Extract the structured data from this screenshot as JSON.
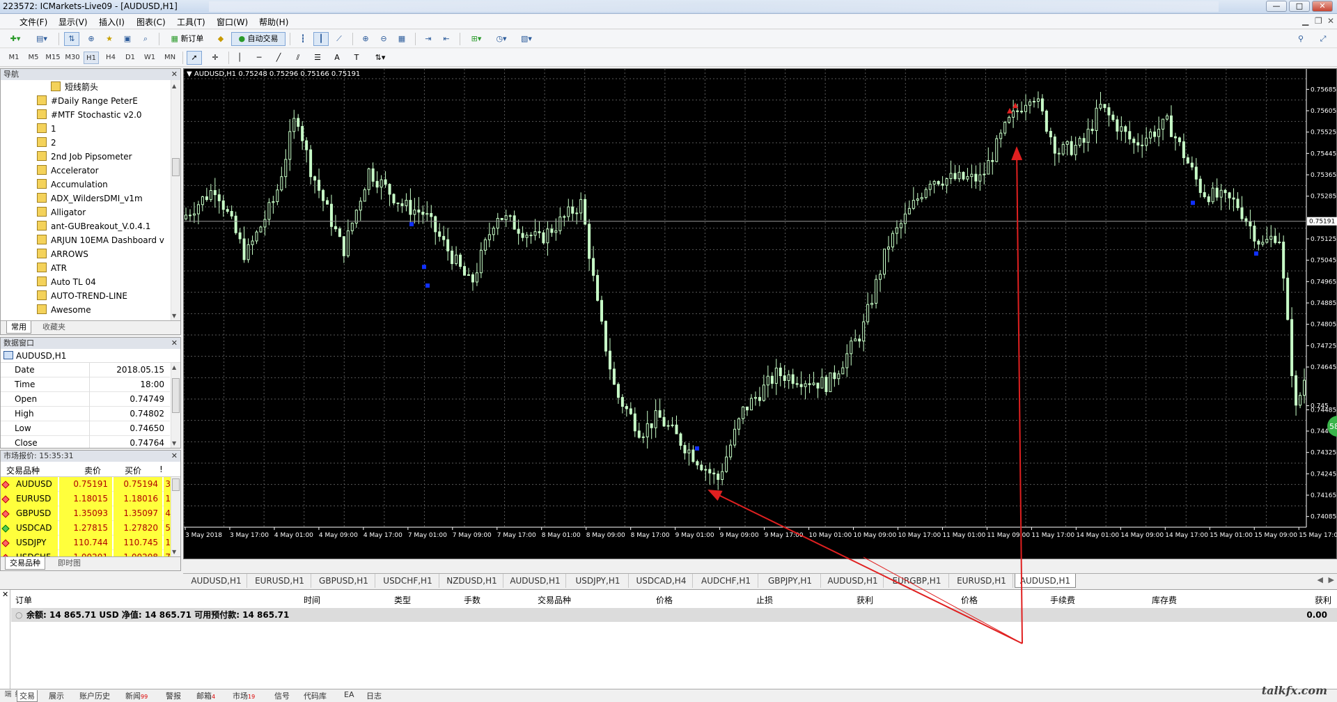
{
  "window": {
    "title": "223572: ICMarkets-Live09 - [AUDUSD,H1]",
    "btn_min": "—",
    "btn_max": "□",
    "btn_close": "✕"
  },
  "menu": [
    "文件(F)",
    "显示(V)",
    "插入(I)",
    "图表(C)",
    "工具(T)",
    "窗口(W)",
    "帮助(H)"
  ],
  "toolbar": {
    "new_order": "新订单",
    "auto_trade": "自动交易"
  },
  "timeframes": [
    "M1",
    "M5",
    "M15",
    "M30",
    "H1",
    "H4",
    "D1",
    "W1",
    "MN"
  ],
  "timeframe_active": "H1",
  "navigator": {
    "title": "导航",
    "items": [
      "短线箭头",
      "#Daily Range PeterE",
      "#MTF Stochastic v2.0",
      "1",
      "2",
      "2nd Job Pipsometer",
      "Accelerator",
      "Accumulation",
      "ADX_WildersDMI_v1m",
      "Alligator",
      "ant-GUBreakout_V.0.4.1",
      "ARJUN 10EMA Dashboard v",
      "ARROWS",
      "ATR",
      "Auto TL 04",
      "AUTO-TREND-LINE",
      "Awesome"
    ],
    "tabs": [
      "常用",
      "收藏夹"
    ]
  },
  "data_window": {
    "title": "数据窗口",
    "symbol": "AUDUSD,H1",
    "rows": [
      {
        "k": "Date",
        "v": "2018.05.15"
      },
      {
        "k": "Time",
        "v": "18:00"
      },
      {
        "k": "Open",
        "v": "0.74749"
      },
      {
        "k": "High",
        "v": "0.74802"
      },
      {
        "k": "Low",
        "v": "0.74650"
      },
      {
        "k": "Close",
        "v": "0.74764"
      }
    ]
  },
  "market_watch": {
    "title": "市场报价: 15:35:31",
    "headers": [
      "交易品种",
      "卖价",
      "买价",
      "!"
    ],
    "rows": [
      {
        "sym": "AUDUSD",
        "bid": "0.75191",
        "ask": "0.75194",
        "spread": "3",
        "up": false
      },
      {
        "sym": "EURUSD",
        "bid": "1.18015",
        "ask": "1.18016",
        "spread": "1",
        "up": false
      },
      {
        "sym": "GBPUSD",
        "bid": "1.35093",
        "ask": "1.35097",
        "spread": "4",
        "up": false
      },
      {
        "sym": "USDCAD",
        "bid": "1.27815",
        "ask": "1.27820",
        "spread": "5",
        "up": true
      },
      {
        "sym": "USDJPY",
        "bid": "110.744",
        "ask": "110.745",
        "spread": "1",
        "up": false
      },
      {
        "sym": "USDCHF",
        "bid": "1.00201",
        "ask": "1.00208",
        "spread": "7",
        "up": false
      }
    ],
    "tabs": [
      "交易品种",
      "即时图"
    ]
  },
  "chart": {
    "header": "AUDUSD,H1  0.75248 0.75296 0.75166 0.75191",
    "current_price": "0.75191",
    "price_labels": [
      "0.75685",
      "0.75605",
      "0.75525",
      "0.75445",
      "0.75365",
      "0.75285",
      "0.75125",
      "0.75045",
      "0.74965",
      "0.74885",
      "0.74805",
      "0.74725",
      "0.74645",
      "0.745",
      "0.74485",
      "0.74405",
      "0.74325",
      "0.74245",
      "0.74165",
      "0.74085"
    ],
    "time_labels": [
      "3 May 2018",
      "3 May 17:00",
      "4 May 01:00",
      "4 May 09:00",
      "4 May 17:00",
      "7 May 01:00",
      "7 May 09:00",
      "7 May 17:00",
      "8 May 01:00",
      "8 May 09:00",
      "8 May 17:00",
      "9 May 01:00",
      "9 May 09:00",
      "9 May 17:00",
      "10 May 01:00",
      "10 May 09:00",
      "10 May 17:00",
      "11 May 01:00",
      "11 May 09:00",
      "11 May 17:00",
      "14 May 01:00",
      "14 May 09:00",
      "14 May 17:00",
      "15 May 01:00",
      "15 May 09:00",
      "15 May 17:00"
    ],
    "ymax": 0.75725,
    "ymin": 0.74045,
    "colors": {
      "bg": "#000000",
      "grid": "#5a5a5a",
      "candle": "#c8ffc8",
      "arrow": "#e02020",
      "marker": "#1030ff"
    },
    "badge": "58"
  },
  "chart_tabs": [
    "AUDUSD,H1",
    "EURUSD,H1",
    "GBPUSD,H1",
    "USDCHF,H1",
    "NZDUSD,H1",
    "AUDUSD,H1",
    "USDJPY,H1",
    "USDCAD,H4",
    "AUDCHF,H1",
    "GBPJPY,H1",
    "AUDUSD,H1",
    "EURGBP,H1",
    "EURUSD,H1",
    "AUDUSD,H1"
  ],
  "terminal": {
    "headers": [
      "订单",
      "时间",
      "类型",
      "手数",
      "交易品种",
      "价格",
      "止损",
      "获利",
      "价格",
      "手续费",
      "库存费",
      "获利"
    ],
    "balance": "余额: 14 865.71 USD  净值: 14 865.71  可用预付款: 14 865.71",
    "profit": "0.00",
    "tabs": [
      {
        "label": "交易",
        "sup": ""
      },
      {
        "label": "展示",
        "sup": ""
      },
      {
        "label": "账户历史",
        "sup": ""
      },
      {
        "label": "新闻",
        "sup": "99"
      },
      {
        "label": "警报",
        "sup": ""
      },
      {
        "label": "邮箱",
        "sup": "4"
      },
      {
        "label": "市场",
        "sup": "19"
      },
      {
        "label": "信号",
        "sup": ""
      },
      {
        "label": "代码库",
        "sup": ""
      },
      {
        "label": "EA",
        "sup": ""
      },
      {
        "label": "日志",
        "sup": ""
      }
    ],
    "side_label": "终端"
  },
  "watermark": "talkfx.com"
}
